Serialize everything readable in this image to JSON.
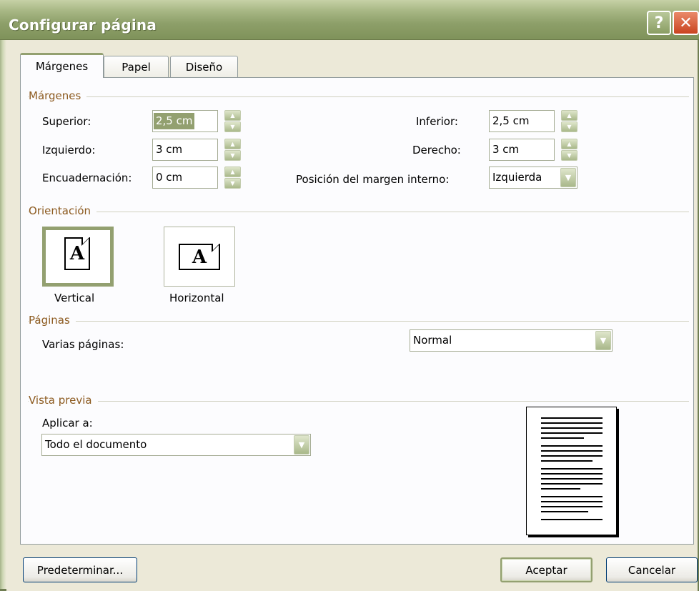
{
  "window": {
    "title": "Configurar página",
    "help_label": "?",
    "close_label": "✕"
  },
  "tabs": [
    {
      "label": "Márgenes",
      "active": true
    },
    {
      "label": "Papel",
      "active": false
    },
    {
      "label": "Diseño",
      "active": false
    }
  ],
  "margins": {
    "section_label": "Márgenes",
    "top_label": "Superior:",
    "top_value": "2,5 cm",
    "bottom_label": "Inferior:",
    "bottom_value": "2,5 cm",
    "left_label": "Izquierdo:",
    "left_value": "3 cm",
    "right_label": "Derecho:",
    "right_value": "3 cm",
    "gutter_label": "Encuadernación:",
    "gutter_value": "0 cm",
    "gutter_pos_label": "Posición del margen interno:",
    "gutter_pos_value": "Izquierda"
  },
  "orientation": {
    "section_label": "Orientación",
    "portrait_label": "Vertical",
    "landscape_label": "Horizontal",
    "icon_letter": "A",
    "selected": "Vertical"
  },
  "pages": {
    "section_label": "Páginas",
    "multiple_label": "Varias páginas:",
    "multiple_value": "Normal"
  },
  "preview": {
    "section_label": "Vista previa",
    "apply_label": "Aplicar a:",
    "apply_value": "Todo el documento"
  },
  "buttons": {
    "default_label": "Predeterminar...",
    "ok_label": "Aceptar",
    "cancel_label": "Cancelar"
  },
  "colors": {
    "accent": "#93a070",
    "group_label": "#8c5a1f",
    "title_bar": "#8d9f69"
  }
}
